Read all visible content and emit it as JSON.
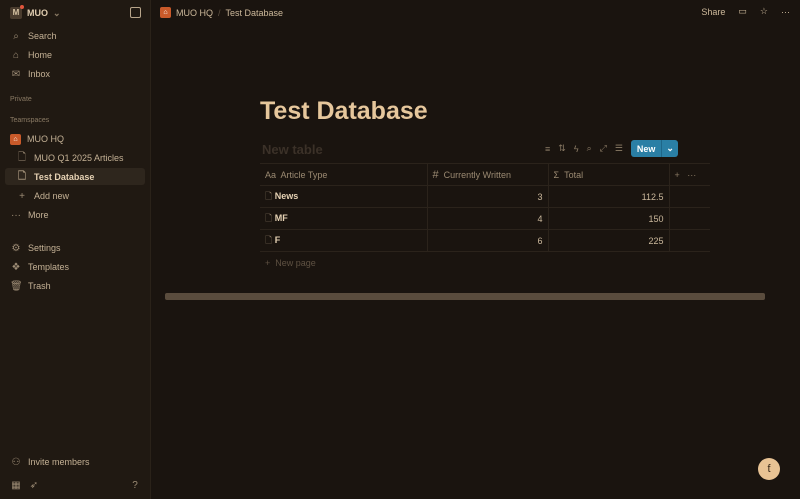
{
  "sidebar": {
    "workspace": "MUO",
    "workspace_initial": "M",
    "nav": [
      "Search",
      "Home",
      "Inbox"
    ],
    "private": "Private",
    "teamspaces": "Teamspaces",
    "team": "MUO HQ",
    "pages": [
      "MUO Q1 2025 Articles",
      "Test Database"
    ],
    "add_new": "Add new",
    "more": "More",
    "bottom": [
      "Settings",
      "Templates",
      "Trash"
    ],
    "invite": "Invite members"
  },
  "header": {
    "breadcrumb": [
      "MUO HQ",
      "Test Database"
    ],
    "share": "Share"
  },
  "page": {
    "title": "Test Database",
    "table_title": "New table",
    "new_button": "New",
    "columns": [
      "Article Type",
      "Currently Written",
      "Total"
    ],
    "rows": [
      {
        "name": "News",
        "written": "3",
        "total": "112.5"
      },
      {
        "name": "MF",
        "written": "4",
        "total": "150"
      },
      {
        "name": "F",
        "written": "6",
        "total": "225"
      }
    ],
    "new_page": "New page"
  },
  "accent": "#2a7fa5"
}
